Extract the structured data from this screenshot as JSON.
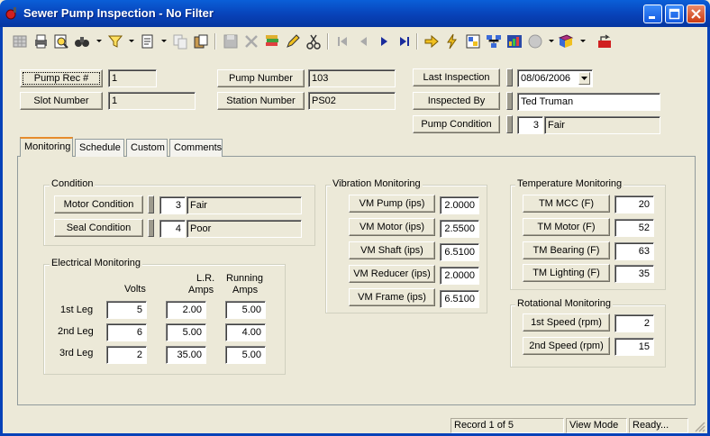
{
  "window": {
    "title": "Sewer Pump Inspection - No Filter",
    "accent": "#0842b8"
  },
  "toolbar": {
    "icons": [
      "grid-icon",
      "print-icon",
      "print-preview-icon",
      "binoculars-icon",
      "filter-icon",
      "report-icon",
      "copy-icon",
      "paste-icon",
      "save-icon",
      "delete-icon",
      "stack-icon",
      "edit-icon",
      "cut-icon",
      "first-record-icon",
      "prev-record-icon",
      "next-record-icon",
      "last-record-icon",
      "go-arrow-icon",
      "lightning-icon",
      "table-link-icon",
      "network-icon",
      "chart-icon",
      "globe-icon",
      "book-icon",
      "exit-icon"
    ]
  },
  "header": {
    "pump_rec_label": "Pump Rec #",
    "pump_rec_value": "1",
    "slot_number_label": "Slot Number",
    "slot_number_value": "1",
    "pump_number_label": "Pump Number",
    "pump_number_value": "103",
    "station_number_label": "Station Number",
    "station_number_value": "PS02",
    "last_inspection_label": "Last Inspection",
    "last_inspection_value": "08/06/2006",
    "inspected_by_label": "Inspected By",
    "inspected_by_value": "Ted Truman",
    "pump_condition_label": "Pump Condition",
    "pump_condition_code": "3",
    "pump_condition_text": "Fair"
  },
  "tabs": [
    "Monitoring",
    "Schedule",
    "Custom",
    "Comments"
  ],
  "condition": {
    "title": "Condition",
    "motor_label": "Motor Condition",
    "motor_code": "3",
    "motor_text": "Fair",
    "seal_label": "Seal Condition",
    "seal_code": "4",
    "seal_text": "Poor"
  },
  "electrical": {
    "title": "Electrical Monitoring",
    "col_volts": "Volts",
    "col_lr_1": "L.R.",
    "col_lr_2": "Amps",
    "col_run_1": "Running",
    "col_run_2": "Amps",
    "rows": [
      {
        "label": "1st Leg",
        "volts": "5",
        "lr": "2.00",
        "run": "5.00"
      },
      {
        "label": "2nd Leg",
        "volts": "6",
        "lr": "5.00",
        "run": "4.00"
      },
      {
        "label": "3rd Leg",
        "volts": "2",
        "lr": "35.00",
        "run": "5.00"
      }
    ]
  },
  "vibration": {
    "title": "Vibration Monitoring",
    "rows": [
      {
        "label": "VM Pump (ips)",
        "value": "2.0000"
      },
      {
        "label": "VM Motor (ips)",
        "value": "2.5500"
      },
      {
        "label": "VM Shaft (ips)",
        "value": "6.5100"
      },
      {
        "label": "VM Reducer (ips)",
        "value": "2.0000"
      },
      {
        "label": "VM Frame (ips)",
        "value": "6.5100"
      }
    ]
  },
  "temperature": {
    "title": "Temperature Monitoring",
    "rows": [
      {
        "label": "TM MCC (F)",
        "value": "20"
      },
      {
        "label": "TM Motor (F)",
        "value": "52"
      },
      {
        "label": "TM Bearing (F)",
        "value": "63"
      },
      {
        "label": "TM Lighting (F)",
        "value": "35"
      }
    ]
  },
  "rotational": {
    "title": "Rotational Monitoring",
    "rows": [
      {
        "label": "1st Speed (rpm)",
        "value": "2"
      },
      {
        "label": "2nd Speed (rpm)",
        "value": "15"
      }
    ]
  },
  "status": {
    "record": "Record 1 of 5",
    "mode": "View Mode",
    "state": "Ready..."
  }
}
